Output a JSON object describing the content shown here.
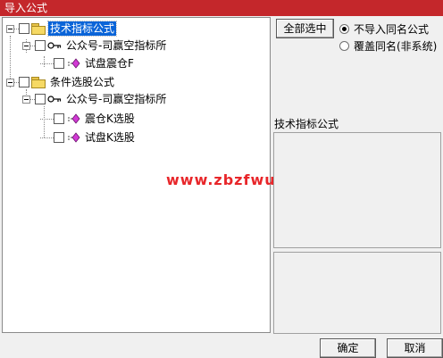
{
  "window": {
    "title": "导入公式"
  },
  "tree": {
    "nodes": [
      {
        "label": "技术指标公式",
        "icon": "folder-icon",
        "selected": true
      },
      {
        "label": "公众号-司赢空指标所",
        "icon": "key-icon"
      },
      {
        "label": "试盘震仓F",
        "icon": "formula-icon"
      },
      {
        "label": "条件选股公式",
        "icon": "folder-icon"
      },
      {
        "label": "公众号-司赢空指标所",
        "icon": "key-icon"
      },
      {
        "label": "震仓K选股",
        "icon": "formula-icon"
      },
      {
        "label": "试盘K选股",
        "icon": "formula-icon"
      }
    ]
  },
  "watermark": "www.zbzfwu.com",
  "options": {
    "select_all_label": "全部选中",
    "radio_no_import": "不导入同名公式",
    "radio_overwrite": "覆盖同名(非系统)",
    "selected_radio": "no_import"
  },
  "info": {
    "label": "技术指标公式"
  },
  "footer": {
    "ok_label": "确定",
    "cancel_label": "取消"
  },
  "colors": {
    "titlebar": "#c4272b",
    "selection": "#0a64d8",
    "watermark": "#e8262a"
  }
}
